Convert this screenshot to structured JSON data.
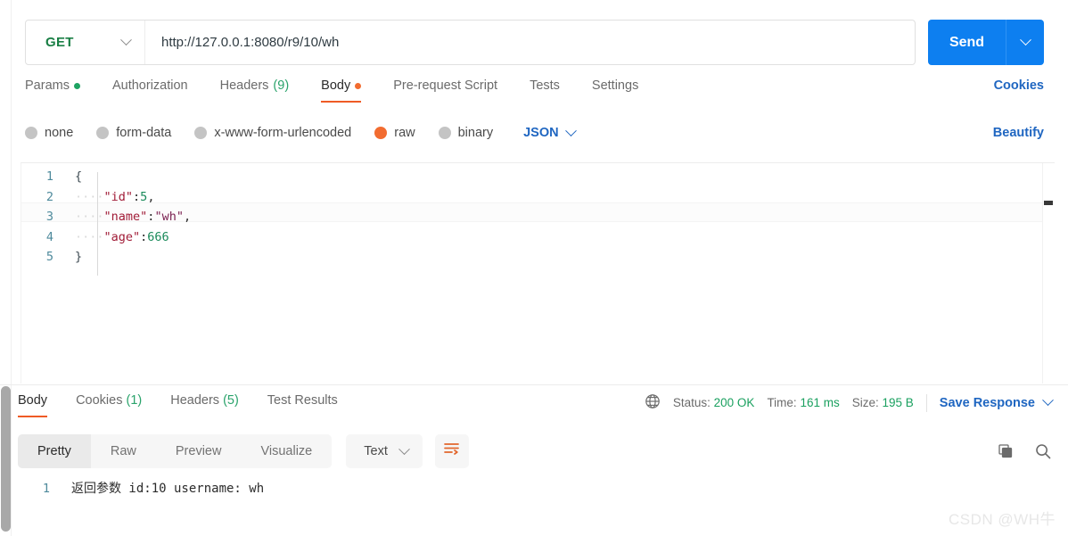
{
  "request": {
    "method": "GET",
    "url": "http://127.0.0.1:8080/r9/10/wh",
    "send_label": "Send",
    "tabs": [
      {
        "label": "Params",
        "dot": "green"
      },
      {
        "label": "Authorization"
      },
      {
        "label": "Headers",
        "count": "(9)"
      },
      {
        "label": "Body",
        "dot": "orange"
      },
      {
        "label": "Pre-request Script"
      },
      {
        "label": "Tests"
      },
      {
        "label": "Settings"
      }
    ],
    "cookies_link": "Cookies",
    "body_types": [
      {
        "label": "none"
      },
      {
        "label": "form-data"
      },
      {
        "label": "x-www-form-urlencoded"
      },
      {
        "label": "raw"
      },
      {
        "label": "binary"
      }
    ],
    "content_type": "JSON",
    "beautify_link": "Beautify"
  },
  "editor": {
    "lines": [
      {
        "num": "1",
        "open": "{"
      },
      {
        "num": "2",
        "indent": "····",
        "key": "\"id\"",
        "colon": ":",
        "num_val": "5",
        "comma": ","
      },
      {
        "num": "3",
        "indent": "····",
        "key": "\"name\"",
        "colon": ":",
        "str_val": "\"wh\"",
        "comma": ","
      },
      {
        "num": "4",
        "indent": "····",
        "key": "\"age\"",
        "colon": ":",
        "num_val": "666"
      },
      {
        "num": "5",
        "close": "}"
      }
    ]
  },
  "response": {
    "tabs": [
      {
        "label": "Body"
      },
      {
        "label": "Cookies",
        "count": "(1)"
      },
      {
        "label": "Headers",
        "count": "(5)"
      },
      {
        "label": "Test Results"
      }
    ],
    "status_label": "Status:",
    "status_value": "200 OK",
    "time_label": "Time:",
    "time_value": "161 ms",
    "size_label": "Size:",
    "size_value": "195 B",
    "save_response": "Save Response",
    "view_modes": [
      {
        "label": "Pretty"
      },
      {
        "label": "Raw"
      },
      {
        "label": "Preview"
      },
      {
        "label": "Visualize"
      }
    ],
    "format": "Text",
    "body_line_num": "1",
    "body_text": "返回参数 id:10 username: wh"
  },
  "watermark": "CSDN @WH牛",
  "colors": {
    "accent_orange": "#ef5b25",
    "link_blue": "#1f66c1",
    "send_blue": "#0d7ff0",
    "method_green": "#1a7f45",
    "status_green": "#1aa05f"
  }
}
